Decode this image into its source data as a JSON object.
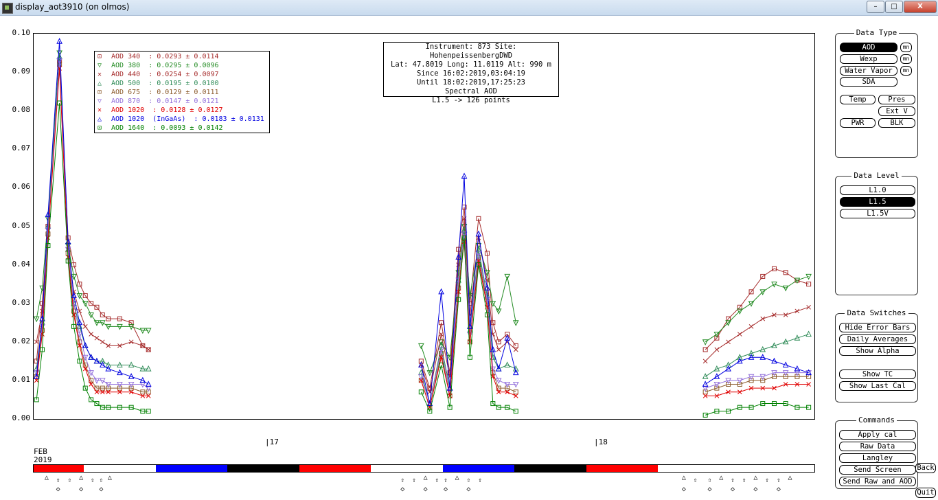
{
  "window": {
    "title": "display_aot3910 (on olmos)",
    "min_label": "–",
    "max_label": "□",
    "close_label": "X"
  },
  "info": {
    "line1": "Instrument: 873 Site: HohenpeissenbergDWD",
    "line2": "Lat: 47.8019 Long: 11.0119 Alt: 990 m",
    "line3": "Since 16:02:2019,03:04:19",
    "line4": "Until 18:02:2019,17:25:23",
    "line5": "Spectral AOD",
    "line6": "L1.5 -> 126 points"
  },
  "xaxis": {
    "month": "FEB",
    "year": "2019",
    "day17": "|17",
    "day18": "|18"
  },
  "panels": {
    "data_type": {
      "title": "Data Type",
      "aod": "AOD",
      "wexp": "Wexp",
      "water_vapor": "Water Vapor",
      "sda": "SDA",
      "mn": "mn",
      "temp": "Temp",
      "pres": "Pres",
      "ext_v": "Ext V",
      "pwr": "PWR",
      "blk": "BLK"
    },
    "data_level": {
      "title": "Data Level",
      "l10": "L1.0",
      "l15": "L1.5",
      "l15v": "L1.5V"
    },
    "data_switches": {
      "title": "Data Switches",
      "hide_error_bars": "Hide Error Bars",
      "daily_averages": "Daily Averages",
      "show_alpha": "Show Alpha",
      "show_tc": "Show TC",
      "show_last_cal": "Show Last Cal"
    },
    "commands": {
      "title": "Commands",
      "apply_cal": "Apply cal",
      "raw_data": "Raw Data",
      "langley": "Langley",
      "send_screen": "Send Screen",
      "send_raw_and_aod": "Send Raw and AOD"
    },
    "back": "Back",
    "quit": "Quit"
  },
  "colors": {
    "aod340": "#a52a2a",
    "aod380": "#228b22",
    "aod440": "#a52a2a",
    "aod500": "#2e8b57",
    "aod675": "#8b5a2b",
    "aod870": "#9370db",
    "aod1020": "#e00000",
    "aod1020ingaas": "#0000e0",
    "aod1640": "#008000"
  },
  "chart_data": {
    "type": "scatter",
    "title": "",
    "xlabel": "",
    "ylabel": "",
    "ylim": [
      0,
      0.1
    ],
    "xlim": [
      16.0,
      18.72
    ],
    "yticks": [
      "0.00",
      "0.01",
      "0.02",
      "0.03",
      "0.04",
      "0.05",
      "0.06",
      "0.07",
      "0.08",
      "0.09",
      "0.10"
    ],
    "legend_position": "top-left",
    "series": [
      {
        "name": "AOD 340",
        "stat": "  : 0.0293 ± 0.0114",
        "symbol": "⊡",
        "color": "#a52a2a",
        "x": [
          16.01,
          16.03,
          16.05,
          16.09,
          16.12,
          16.14,
          16.16,
          16.18,
          16.2,
          16.22,
          16.24,
          16.26,
          16.3,
          16.34,
          16.38,
          16.4,
          17.35,
          17.38,
          17.42,
          17.45,
          17.48,
          17.5,
          17.52,
          17.55,
          17.58,
          17.6,
          17.62,
          17.65,
          17.68,
          18.34,
          18.38,
          18.42,
          18.46,
          18.5,
          18.54,
          18.58,
          18.62,
          18.66,
          18.7
        ],
        "y": [
          0.015,
          0.03,
          0.05,
          0.093,
          0.047,
          0.04,
          0.035,
          0.032,
          0.03,
          0.029,
          0.027,
          0.026,
          0.026,
          0.025,
          0.019,
          0.018,
          0.015,
          0.008,
          0.025,
          0.012,
          0.044,
          0.055,
          0.03,
          0.052,
          0.043,
          0.025,
          0.02,
          0.022,
          0.019,
          0.018,
          0.021,
          0.026,
          0.029,
          0.033,
          0.037,
          0.039,
          0.038,
          0.036,
          0.035
        ]
      },
      {
        "name": "AOD 380",
        "stat": "  : 0.0295 ± 0.0096",
        "symbol": "▽",
        "color": "#228b22",
        "x": [
          16.01,
          16.03,
          16.05,
          16.09,
          16.12,
          16.14,
          16.16,
          16.18,
          16.2,
          16.22,
          16.24,
          16.26,
          16.3,
          16.34,
          16.38,
          16.4,
          17.35,
          17.38,
          17.42,
          17.45,
          17.48,
          17.5,
          17.52,
          17.55,
          17.58,
          17.6,
          17.62,
          17.65,
          17.68,
          18.34,
          18.38,
          18.42,
          18.46,
          18.5,
          18.54,
          18.58,
          18.62,
          18.66,
          18.7
        ],
        "y": [
          0.026,
          0.034,
          0.052,
          0.095,
          0.045,
          0.037,
          0.032,
          0.03,
          0.027,
          0.025,
          0.025,
          0.024,
          0.024,
          0.024,
          0.023,
          0.023,
          0.019,
          0.012,
          0.02,
          0.016,
          0.038,
          0.05,
          0.032,
          0.045,
          0.038,
          0.03,
          0.028,
          0.037,
          0.025,
          0.02,
          0.022,
          0.025,
          0.028,
          0.03,
          0.033,
          0.035,
          0.034,
          0.036,
          0.037
        ]
      },
      {
        "name": "AOD 440",
        "stat": "  : 0.0254 ± 0.0097",
        "symbol": "✕",
        "color": "#a52a2a",
        "x": [
          16.01,
          16.03,
          16.05,
          16.09,
          16.12,
          16.14,
          16.16,
          16.18,
          16.2,
          16.22,
          16.24,
          16.26,
          16.3,
          16.34,
          16.38,
          16.4,
          17.35,
          17.38,
          17.42,
          17.45,
          17.48,
          17.5,
          17.52,
          17.55,
          17.58,
          17.6,
          17.62,
          17.65,
          17.68,
          18.34,
          18.38,
          18.42,
          18.46,
          18.5,
          18.54,
          18.58,
          18.62,
          18.66,
          18.7
        ],
        "y": [
          0.02,
          0.028,
          0.049,
          0.092,
          0.044,
          0.033,
          0.028,
          0.024,
          0.022,
          0.021,
          0.02,
          0.019,
          0.019,
          0.02,
          0.019,
          0.018,
          0.014,
          0.007,
          0.022,
          0.011,
          0.04,
          0.052,
          0.027,
          0.047,
          0.036,
          0.022,
          0.018,
          0.02,
          0.018,
          0.015,
          0.018,
          0.02,
          0.022,
          0.024,
          0.026,
          0.027,
          0.027,
          0.028,
          0.029
        ]
      },
      {
        "name": "AOD 500",
        "stat": "  : 0.0195 ± 0.0100",
        "symbol": "△",
        "color": "#2e8b57",
        "x": [
          16.01,
          16.03,
          16.05,
          16.09,
          16.12,
          16.14,
          16.16,
          16.18,
          16.2,
          16.22,
          16.24,
          16.26,
          16.3,
          16.34,
          16.38,
          16.4,
          17.35,
          17.38,
          17.42,
          17.45,
          17.48,
          17.5,
          17.52,
          17.55,
          17.58,
          17.6,
          17.62,
          17.65,
          17.68,
          18.34,
          18.38,
          18.42,
          18.46,
          18.5,
          18.54,
          18.58,
          18.62,
          18.66,
          18.7
        ],
        "y": [
          0.013,
          0.025,
          0.05,
          0.094,
          0.044,
          0.03,
          0.024,
          0.019,
          0.016,
          0.015,
          0.015,
          0.014,
          0.014,
          0.014,
          0.013,
          0.013,
          0.012,
          0.004,
          0.019,
          0.008,
          0.036,
          0.049,
          0.023,
          0.044,
          0.032,
          0.016,
          0.013,
          0.014,
          0.013,
          0.011,
          0.013,
          0.014,
          0.016,
          0.017,
          0.018,
          0.019,
          0.02,
          0.021,
          0.022
        ]
      },
      {
        "name": "AOD 675",
        "stat": "  : 0.0129 ± 0.0111",
        "symbol": "⊡",
        "color": "#8b5a2b",
        "x": [
          16.01,
          16.03,
          16.05,
          16.09,
          16.12,
          16.14,
          16.16,
          16.18,
          16.2,
          16.22,
          16.24,
          16.26,
          16.3,
          16.34,
          16.38,
          16.4,
          17.35,
          17.38,
          17.42,
          17.45,
          17.48,
          17.5,
          17.52,
          17.55,
          17.58,
          17.6,
          17.62,
          17.65,
          17.68,
          18.34,
          18.38,
          18.42,
          18.46,
          18.5,
          18.54,
          18.58,
          18.62,
          18.66,
          18.7
        ],
        "y": [
          0.011,
          0.023,
          0.048,
          0.092,
          0.043,
          0.028,
          0.02,
          0.014,
          0.01,
          0.008,
          0.008,
          0.008,
          0.008,
          0.008,
          0.007,
          0.007,
          0.01,
          0.003,
          0.017,
          0.006,
          0.034,
          0.047,
          0.02,
          0.042,
          0.03,
          0.012,
          0.008,
          0.008,
          0.007,
          0.007,
          0.008,
          0.009,
          0.009,
          0.01,
          0.01,
          0.011,
          0.011,
          0.011,
          0.011
        ]
      },
      {
        "name": "AOD 870",
        "stat": "  : 0.0147 ± 0.0121",
        "symbol": "▽",
        "color": "#9370db",
        "x": [
          16.01,
          16.03,
          16.05,
          16.09,
          16.12,
          16.14,
          16.16,
          16.18,
          16.2,
          16.22,
          16.24,
          16.26,
          16.3,
          16.34,
          16.38,
          16.4,
          17.35,
          17.38,
          17.42,
          17.45,
          17.48,
          17.5,
          17.52,
          17.55,
          17.58,
          17.6,
          17.62,
          17.65,
          17.68,
          18.34,
          18.38,
          18.42,
          18.46,
          18.5,
          18.54,
          18.58,
          18.62,
          18.66,
          18.7
        ],
        "y": [
          0.012,
          0.024,
          0.049,
          0.093,
          0.044,
          0.03,
          0.022,
          0.016,
          0.012,
          0.01,
          0.01,
          0.009,
          0.009,
          0.009,
          0.009,
          0.008,
          0.011,
          0.004,
          0.018,
          0.007,
          0.036,
          0.048,
          0.022,
          0.043,
          0.031,
          0.013,
          0.01,
          0.009,
          0.009,
          0.008,
          0.009,
          0.01,
          0.01,
          0.011,
          0.011,
          0.012,
          0.012,
          0.012,
          0.012
        ]
      },
      {
        "name": "AOD 1020",
        "stat": "  : 0.0128 ± 0.0127",
        "symbol": "✕",
        "color": "#e00000",
        "x": [
          16.01,
          16.03,
          16.05,
          16.09,
          16.12,
          16.14,
          16.16,
          16.18,
          16.2,
          16.22,
          16.24,
          16.26,
          16.3,
          16.34,
          16.38,
          16.4,
          17.35,
          17.38,
          17.42,
          17.45,
          17.48,
          17.5,
          17.52,
          17.55,
          17.58,
          17.6,
          17.62,
          17.65,
          17.68,
          18.34,
          18.38,
          18.42,
          18.46,
          18.5,
          18.54,
          18.58,
          18.62,
          18.66,
          18.7
        ],
        "y": [
          0.01,
          0.022,
          0.047,
          0.091,
          0.042,
          0.027,
          0.019,
          0.013,
          0.009,
          0.007,
          0.007,
          0.007,
          0.007,
          0.007,
          0.006,
          0.006,
          0.01,
          0.003,
          0.016,
          0.006,
          0.033,
          0.046,
          0.02,
          0.041,
          0.029,
          0.011,
          0.007,
          0.007,
          0.006,
          0.006,
          0.006,
          0.007,
          0.007,
          0.008,
          0.008,
          0.008,
          0.009,
          0.009,
          0.009
        ]
      },
      {
        "name": "AOD 1020  (InGaAs)",
        "stat": "  : 0.0183 ± 0.0131",
        "symbol": "△",
        "color": "#0000e0",
        "x": [
          16.01,
          16.03,
          16.05,
          16.09,
          16.12,
          16.14,
          16.16,
          16.18,
          16.2,
          16.22,
          16.24,
          16.26,
          16.3,
          16.34,
          16.38,
          16.4,
          17.35,
          17.38,
          17.42,
          17.45,
          17.48,
          17.5,
          17.52,
          17.55,
          17.58,
          17.6,
          17.62,
          17.65,
          17.68,
          18.34,
          18.38,
          18.42,
          18.46,
          18.5,
          18.54,
          18.58,
          18.62,
          18.66,
          18.7
        ],
        "y": [
          0.011,
          0.026,
          0.053,
          0.098,
          0.046,
          0.032,
          0.025,
          0.019,
          0.016,
          0.015,
          0.014,
          0.013,
          0.012,
          0.011,
          0.01,
          0.009,
          0.014,
          0.004,
          0.033,
          0.008,
          0.042,
          0.063,
          0.024,
          0.048,
          0.034,
          0.018,
          0.013,
          0.021,
          0.012,
          0.009,
          0.011,
          0.013,
          0.015,
          0.016,
          0.016,
          0.015,
          0.014,
          0.013,
          0.012
        ]
      },
      {
        "name": "AOD 1640",
        "stat": "  : 0.0093 ± 0.0142",
        "symbol": "⊡",
        "color": "#008000",
        "x": [
          16.01,
          16.03,
          16.05,
          16.09,
          16.12,
          16.14,
          16.16,
          16.18,
          16.2,
          16.22,
          16.24,
          16.26,
          16.3,
          16.34,
          16.38,
          16.4,
          17.35,
          17.38,
          17.42,
          17.45,
          17.48,
          17.5,
          17.52,
          17.55,
          17.58,
          17.6,
          17.62,
          17.65,
          17.68,
          18.34,
          18.38,
          18.42,
          18.46,
          18.5,
          18.54,
          18.58,
          18.62,
          18.66,
          18.7
        ],
        "y": [
          0.005,
          0.018,
          0.045,
          0.082,
          0.041,
          0.024,
          0.015,
          0.008,
          0.005,
          0.004,
          0.003,
          0.003,
          0.003,
          0.003,
          0.002,
          0.002,
          0.007,
          0.002,
          0.014,
          0.003,
          0.031,
          0.047,
          0.016,
          0.04,
          0.027,
          0.004,
          0.003,
          0.003,
          0.002,
          0.001,
          0.002,
          0.002,
          0.003,
          0.003,
          0.004,
          0.004,
          0.004,
          0.003,
          0.003
        ]
      }
    ]
  },
  "timebar": {
    "segments": [
      {
        "from": 16.0,
        "to": 16.175,
        "color": "red"
      },
      {
        "from": 16.175,
        "to": 16.425,
        "color": "white"
      },
      {
        "from": 16.425,
        "to": 16.675,
        "color": "blue"
      },
      {
        "from": 16.675,
        "to": 16.925,
        "color": "black"
      },
      {
        "from": 16.925,
        "to": 17.175,
        "color": "red"
      },
      {
        "from": 17.175,
        "to": 17.425,
        "color": "white"
      },
      {
        "from": 17.425,
        "to": 17.675,
        "color": "blue"
      },
      {
        "from": 17.675,
        "to": 17.925,
        "color": "black"
      },
      {
        "from": 17.925,
        "to": 18.175,
        "color": "red"
      },
      {
        "from": 18.175,
        "to": 18.37,
        "color": "white"
      }
    ]
  }
}
